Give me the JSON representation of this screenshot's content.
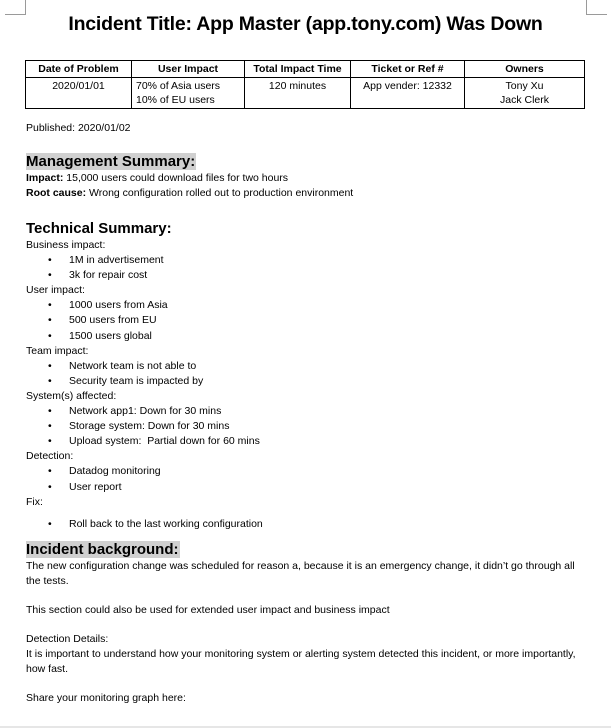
{
  "document": {
    "title": "Incident Title: App Master (app.tony.com) Was Down",
    "summary_table": {
      "headers": [
        "Date of Problem",
        "User Impact",
        "Total Impact Time",
        "Ticket or Ref #",
        "Owners"
      ],
      "row": {
        "date": "2020/01/01",
        "user_impact": [
          "70% of Asia users",
          "10% of EU users"
        ],
        "total_impact_time": "120 minutes",
        "ticket": "App vender: 12332",
        "owners": [
          "Tony Xu",
          "Jack Clerk"
        ]
      }
    },
    "published": "Published: 2020/01/02",
    "management_summary": {
      "heading": "Management Summary:",
      "impact_label": "Impact:",
      "impact_text": " 15,000 users could download files for two hours",
      "root_cause_label": "Root cause:",
      "root_cause_text": " Wrong configuration rolled out to production environment"
    },
    "technical_summary": {
      "heading": "Technical Summary:",
      "bullet": "•",
      "groups": [
        {
          "label": "Business impact:",
          "items": [
            "1M in advertisement",
            "3k for repair cost"
          ]
        },
        {
          "label": "User impact:",
          "items": [
            "1000 users from Asia",
            "500 users from EU",
            "1500 users global"
          ]
        },
        {
          "label": "Team impact:",
          "items": [
            "Network team is not able to",
            "Security team is impacted by"
          ]
        },
        {
          "label": "System(s) affected:",
          "items": [
            "Network app1: Down for 30 mins",
            "Storage system: Down for 30 mins",
            "Upload system:  Partial down for 60 mins"
          ]
        },
        {
          "label": "Detection:",
          "items": [
            "Datadog monitoring",
            "User report"
          ]
        },
        {
          "label": "Fix:",
          "items": [
            "Roll back to the last working configuration"
          ]
        }
      ]
    },
    "incident_background": {
      "heading": "Incident background:",
      "para1": "The new configuration change was scheduled for reason a, because it is an emergency change, it didn’t go through all the tests.",
      "para2": "This section could also be used for extended user impact and business impact",
      "detection_label": "Detection Details:",
      "detection_text": "It is important to understand how your monitoring system or alerting system detected this incident, or more importantly, how fast.",
      "graph_prompt": "Share your monitoring graph here:"
    }
  }
}
